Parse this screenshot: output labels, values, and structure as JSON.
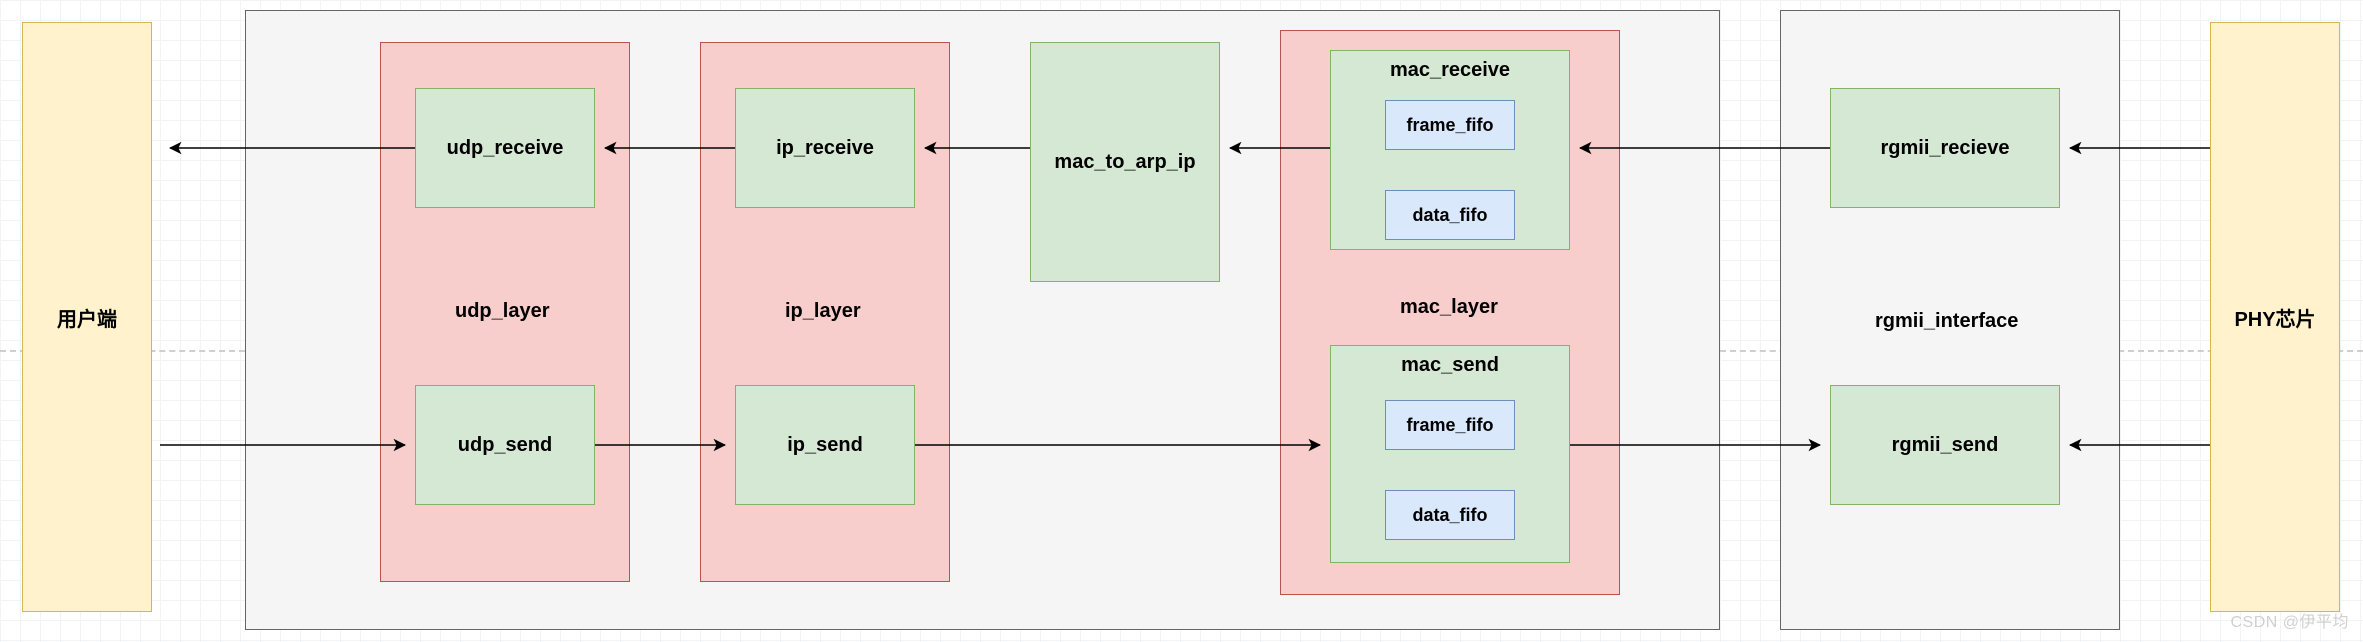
{
  "colors": {
    "yellow_fill": "#FFF2CC",
    "yellow_border": "#D6B656",
    "grey_fill": "#F5F5F5",
    "grey_border": "#666666",
    "red_fill": "#F8CECC",
    "red_border": "#B85450",
    "green_fill": "#D5E8D4",
    "green_border": "#82B366",
    "blue_fill": "#DAE8FC",
    "blue_border": "#6C8EBF",
    "wire": "#000000"
  },
  "endpoint_left": {
    "label": "用户端"
  },
  "endpoint_right": {
    "label": "PHY芯片"
  },
  "main_container": {
    "label": ""
  },
  "udp_layer": {
    "title": "udp_layer",
    "receive": "udp_receive",
    "send": "udp_send"
  },
  "ip_layer": {
    "title": "ip_layer",
    "receive": "ip_receive",
    "send": "ip_send"
  },
  "mac_to_arp_ip": {
    "label": "mac_to_arp_ip"
  },
  "mac_layer": {
    "title": "mac_layer",
    "receive": {
      "title": "mac_receive",
      "frame_fifo": "frame_fifo",
      "data_fifo": "data_fifo"
    },
    "send": {
      "title": "mac_send",
      "frame_fifo": "frame_fifo",
      "data_fifo": "data_fifo"
    }
  },
  "rgmii_interface": {
    "title": "rgmii_interface",
    "receive": "rgmii_recieve",
    "send": "rgmii_send"
  },
  "watermark": "CSDN @伊平均",
  "chart_data": {
    "type": "diagram",
    "title": "Network stack block diagram",
    "nodes": [
      {
        "id": "user",
        "label": "用户端"
      },
      {
        "id": "udp_receive",
        "label": "udp_receive",
        "parent": "udp_layer"
      },
      {
        "id": "udp_send",
        "label": "udp_send",
        "parent": "udp_layer"
      },
      {
        "id": "udp_layer",
        "label": "udp_layer"
      },
      {
        "id": "ip_receive",
        "label": "ip_receive",
        "parent": "ip_layer"
      },
      {
        "id": "ip_send",
        "label": "ip_send",
        "parent": "ip_layer"
      },
      {
        "id": "ip_layer",
        "label": "ip_layer"
      },
      {
        "id": "mac_to_arp_ip",
        "label": "mac_to_arp_ip"
      },
      {
        "id": "mac_receive",
        "label": "mac_receive",
        "parent": "mac_layer",
        "children": [
          "frame_fifo",
          "data_fifo"
        ]
      },
      {
        "id": "mac_send",
        "label": "mac_send",
        "parent": "mac_layer",
        "children": [
          "frame_fifo",
          "data_fifo"
        ]
      },
      {
        "id": "mac_layer",
        "label": "mac_layer"
      },
      {
        "id": "rgmii_recieve",
        "label": "rgmii_recieve",
        "parent": "rgmii_interface"
      },
      {
        "id": "rgmii_send",
        "label": "rgmii_send",
        "parent": "rgmii_interface"
      },
      {
        "id": "rgmii_interface",
        "label": "rgmii_interface"
      },
      {
        "id": "phy",
        "label": "PHY芯片"
      }
    ],
    "edges": [
      {
        "from": "udp_receive",
        "to": "user",
        "dir": "left"
      },
      {
        "from": "ip_receive",
        "to": "udp_receive",
        "dir": "left"
      },
      {
        "from": "mac_to_arp_ip",
        "to": "ip_receive",
        "dir": "left"
      },
      {
        "from": "mac_receive",
        "to": "mac_to_arp_ip",
        "dir": "left"
      },
      {
        "from": "rgmii_recieve",
        "to": "mac_receive",
        "dir": "left"
      },
      {
        "from": "phy",
        "to": "rgmii_recieve",
        "dir": "left"
      },
      {
        "from": "user",
        "to": "udp_send",
        "dir": "right"
      },
      {
        "from": "udp_send",
        "to": "ip_send",
        "dir": "right"
      },
      {
        "from": "ip_send",
        "to": "mac_send",
        "dir": "right"
      },
      {
        "from": "mac_send",
        "to": "rgmii_send",
        "dir": "right"
      },
      {
        "from": "phy",
        "to": "rgmii_send",
        "dir": "left"
      }
    ]
  }
}
